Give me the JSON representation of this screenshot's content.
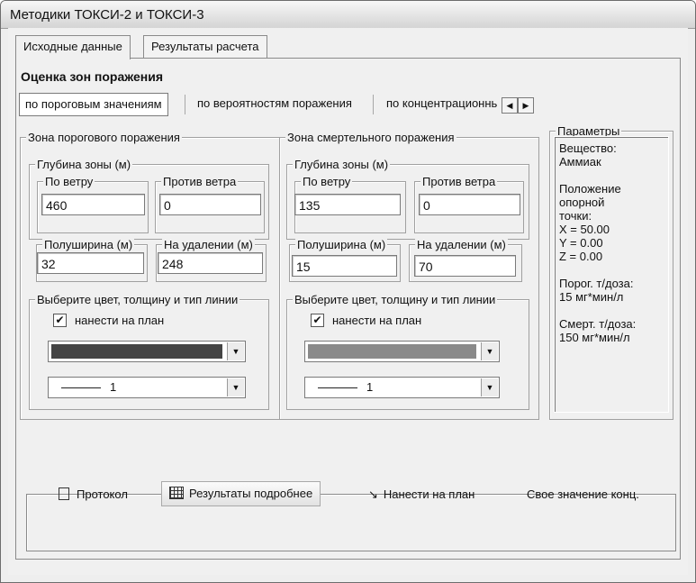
{
  "window": {
    "title": "Методики ТОКСИ-2 и ТОКСИ-3"
  },
  "tabs": [
    {
      "label": "Исходные данные"
    },
    {
      "label": "Результаты расчета"
    }
  ],
  "section_title": "Оценка зон поражения",
  "subtabs": [
    {
      "label": "по пороговым значениям"
    },
    {
      "label": "по вероятностям поражения"
    },
    {
      "label": "по концентрационнь"
    }
  ],
  "threshold_zone": {
    "title": "Зона порогового поражения",
    "depth_title": "Глубина зоны (м)",
    "downwind_label": "По ветру",
    "downwind_value": "460",
    "upwind_label": "Против ветра",
    "upwind_value": "0",
    "halfwidth_label": "Полуширина (м)",
    "halfwidth_value": "32",
    "distance_label": "На удалении (м)",
    "distance_value": "248",
    "style_title": "Выберите цвет, толщину и тип линии",
    "plot_label": "нанести на план",
    "plot_checked": true,
    "color": "#444444",
    "line_width": "1"
  },
  "lethal_zone": {
    "title": "Зона смертельного поражения",
    "depth_title": "Глубина зоны (м)",
    "downwind_label": "По ветру",
    "downwind_value": "135",
    "upwind_label": "Против ветра",
    "upwind_value": "0",
    "halfwidth_label": "Полуширина (м)",
    "halfwidth_value": "15",
    "distance_label": "На удалении (м)",
    "distance_value": "70",
    "style_title": "Выберите цвет, толщину и тип линии",
    "plot_label": "нанести на план",
    "plot_checked": true,
    "color": "#8a8a8a",
    "line_width": "1"
  },
  "params": {
    "title": "Параметры",
    "text": "Вещество:\nАммиак\n\nПоложение\nопорной\nточки:\nX = 50.00\nY = 0.00\nZ = 0.00\n\nПорог. т/доза:\n15 мг*мин/л\n\nСмерт. т/доза:\n150 мг*мин/л"
  },
  "buttons": {
    "protocol": "Протокол",
    "details": "Результаты подробнее",
    "plot": "Нанести на план",
    "custom_conc": "Свое значение конц."
  },
  "icons": {
    "protocol": "document-icon",
    "details": "table-icon",
    "plot": "arrow-plot-icon"
  }
}
